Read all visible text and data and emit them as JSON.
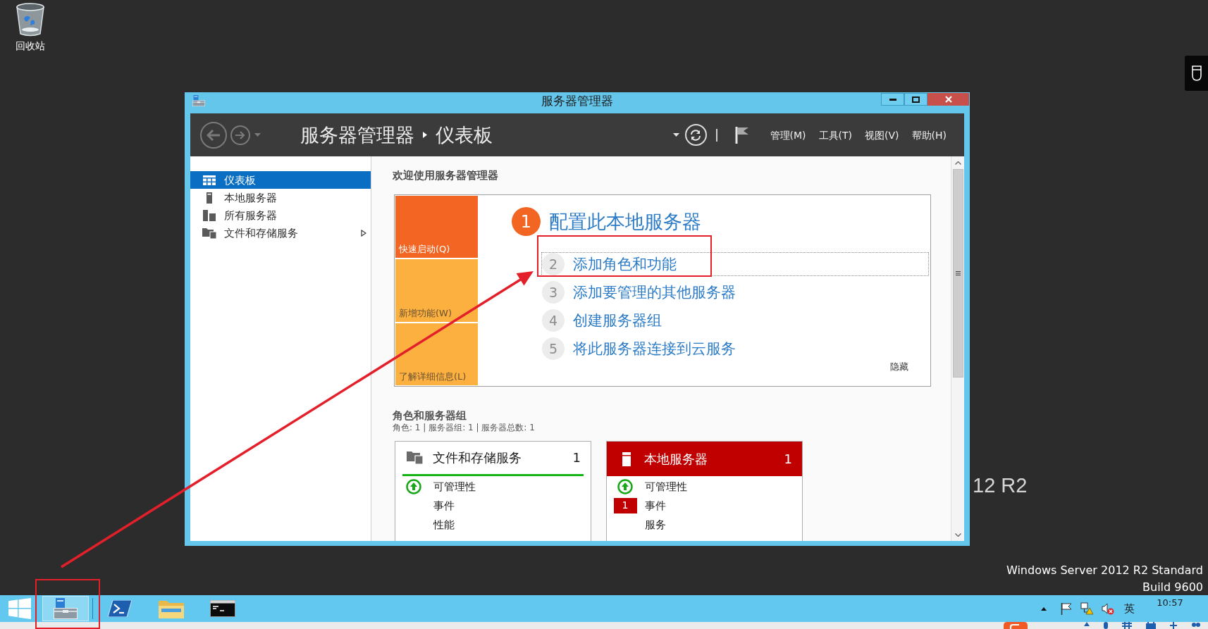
{
  "desktop": {
    "icons": [
      {
        "label": "回收站"
      }
    ],
    "wallpaper": {
      "title_fragment": "12 R2",
      "edition": "Windows Server 2012 R2 Standard",
      "build": "Build 9600"
    }
  },
  "window": {
    "title": "服务器管理器",
    "nav": {
      "back": {
        "disabled": true
      },
      "forward": {
        "disabled": true
      },
      "breadcrumb": [
        "服务器管理器",
        "仪表板"
      ],
      "menus": [
        "管理(M)",
        "工具(T)",
        "视图(V)",
        "帮助(H)"
      ]
    },
    "sidebar": {
      "items": [
        {
          "label": "仪表板",
          "selected": true,
          "has_children": false
        },
        {
          "label": "本地服务器",
          "selected": false,
          "has_children": false
        },
        {
          "label": "所有服务器",
          "selected": false,
          "has_children": false
        },
        {
          "label": "文件和存储服务",
          "selected": false,
          "has_children": true
        }
      ]
    },
    "welcome": {
      "heading": "欢迎使用服务器管理器",
      "tiles": [
        {
          "label": "快速启动(Q)",
          "selected": true
        },
        {
          "label": "新增功能(W)",
          "selected": false
        },
        {
          "label": "了解详细信息(L)",
          "selected": false
        }
      ],
      "title": {
        "number": "1",
        "label": "配置此本地服务器"
      },
      "steps": [
        {
          "number": "2",
          "label": "添加角色和功能",
          "focused": true
        },
        {
          "number": "3",
          "label": "添加要管理的其他服务器",
          "focused": false
        },
        {
          "number": "4",
          "label": "创建服务器组",
          "focused": false
        },
        {
          "number": "5",
          "label": "将此服务器连接到云服务",
          "focused": false
        }
      ],
      "hide": "隐藏"
    },
    "roles": {
      "heading": "角色和服务器组",
      "summary": "角色: 1 | 服务器组: 1 | 服务器总数: 1",
      "cards": [
        {
          "title": "文件和存储服务",
          "count": "1",
          "alert": false,
          "rows": [
            {
              "label": "可管理性",
              "healthy": true
            },
            {
              "label": "事件",
              "healthy": false
            },
            {
              "label": "性能",
              "healthy": false
            }
          ]
        },
        {
          "title": "本地服务器",
          "count": "1",
          "alert": true,
          "rows": [
            {
              "label": "可管理性",
              "healthy": true
            },
            {
              "label": "事件",
              "healthy": false,
              "badge": "1"
            },
            {
              "label": "服务",
              "healthy": false
            }
          ]
        }
      ]
    }
  },
  "taskbar": {
    "apps": [
      {
        "active": true
      },
      {
        "active": false
      },
      {
        "active": false
      },
      {
        "active": false
      }
    ],
    "tray": {
      "ime": "英",
      "time": "10:57"
    }
  }
}
